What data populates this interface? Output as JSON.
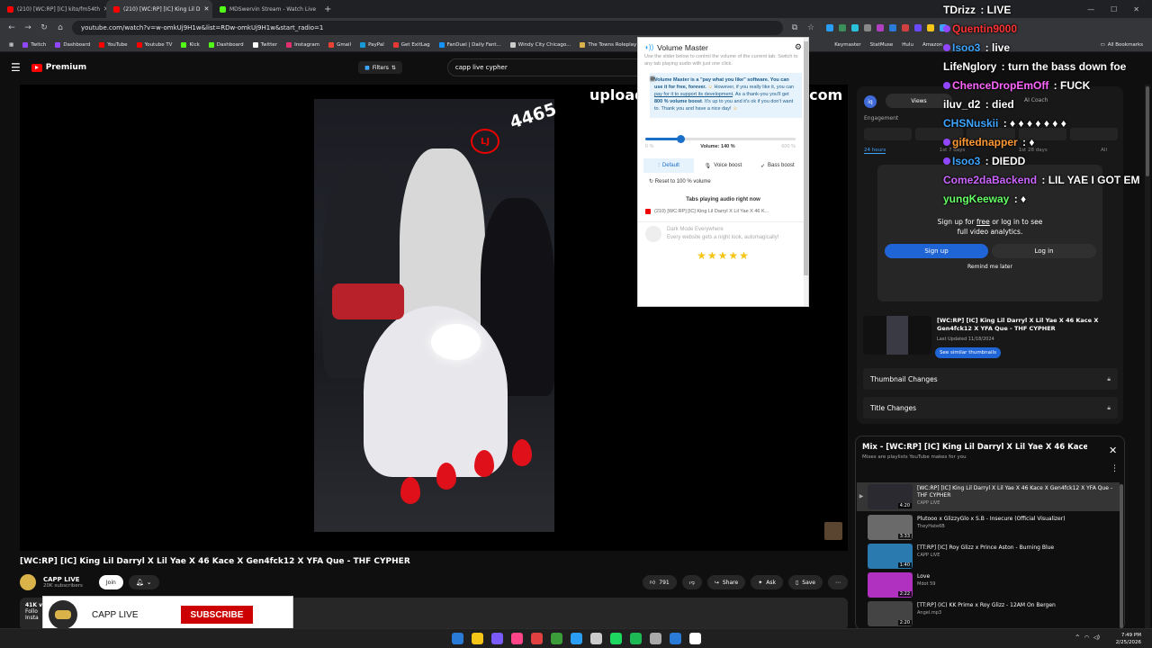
{
  "browser": {
    "tabs": [
      {
        "label": "(210) [WC:RP] [IC] kito/fm54th",
        "favicon": "#ff0000",
        "active": false
      },
      {
        "label": "(210) [WC:RP] [IC] King Lil D",
        "favicon": "#ff0000",
        "active": true
      },
      {
        "label": "MDSwervin Stream - Watch Live",
        "favicon": "#53fc18",
        "active": false
      }
    ],
    "url": "youtube.com/watch?v=w-omkUj9H1w&list=RDw-omkUj9H1w&start_radio=1",
    "bookmarks": [
      {
        "label": "Twitch",
        "color": "#9146ff"
      },
      {
        "label": "Dashboard",
        "color": "#9146ff"
      },
      {
        "label": "YouTube",
        "color": "#ff0000"
      },
      {
        "label": "Youtube TV",
        "color": "#ff0000"
      },
      {
        "label": "Kick",
        "color": "#53fc18"
      },
      {
        "label": "Dashboard",
        "color": "#53fc18"
      },
      {
        "label": "Twitter",
        "color": "#ffffff"
      },
      {
        "label": "Instagram",
        "color": "#e1306c"
      },
      {
        "label": "Gmail",
        "color": "#ea4335"
      },
      {
        "label": "PayPal",
        "color": "#179bd7"
      },
      {
        "label": "Get ExitLag",
        "color": "#e53935"
      },
      {
        "label": "FanDuel | Daily Fant...",
        "color": "#1493ff"
      },
      {
        "label": "Windy City Chicago...",
        "color": "#cccccc"
      },
      {
        "label": "The Towns Roleplay",
        "color": "#d9b24a"
      }
    ],
    "bookmarks_right": "All Bookmarks",
    "ext_bookmarks": [
      "Keymaster",
      "StatMuse",
      "Hulu",
      "Amazon"
    ]
  },
  "youtube": {
    "brand": "Premium",
    "filters_label": "Filters",
    "search_value": "capp live cypher",
    "watermark_left": "upload",
    "watermark_right": ".com",
    "overlay_number": "4465",
    "video_title": "[WC:RP] [IC] King Lil Darryl X Lil Yae X 46 Kace X Gen4fck12 X YFA Que - THF CYPHER",
    "channel_name": "CAPP LIVE",
    "channel_subs": "20K subscribers",
    "join_label": "Join",
    "likes": "791",
    "share_label": "Share",
    "ask_label": "Ask",
    "save_label": "Save",
    "desc_lines": [
      "41K v",
      "Follo",
      "Insta"
    ]
  },
  "subscribe_card": {
    "name": "CAPP LIVE",
    "button": "SUBSCRIBE"
  },
  "volume_master": {
    "title": "Volume Master",
    "subtitle": "Use the slider below to control the volume of the current tab. Switch to any tab playing audio with just one click.",
    "info_bold": "Volume Master is a \"pay what you like\" software. You can use it for free, forever.",
    "info_text_1": "However, if you really like it, you can",
    "info_link": "pay for it to support its development",
    "info_text_2": ". As a thank-you you'll get",
    "info_bold_2": "800 % volume boost",
    "info_text_3": ". It's up to you and it's ok if you don't want to. Thank you and have a nice day!",
    "min_label": "0 %",
    "volume_label": "Volume: 140 %",
    "max_label": "600 %",
    "volume_value": 140,
    "volume_max": 600,
    "modes": [
      "Default",
      "Voice boost",
      "Bass boost"
    ],
    "reset_label": "Reset to 100 % volume",
    "tabs_heading": "Tabs playing audio right now",
    "tab_item": "(210) [WC:RP] [IC] King Lil Darryl X Lil Yae X 46 K...",
    "dark_title": "Dark Mode Everywhere",
    "dark_sub": "Every website gets a night look, automagically!",
    "stars": "★★★★★"
  },
  "right_panel": {
    "views_label": "Views",
    "ai_coach": "AI Coach",
    "engagement": "Engagement",
    "time_tabs": [
      "24 hours",
      "1st 7 days",
      "1st 28 days",
      "All"
    ],
    "signup_text_1": "Sign up for",
    "signup_free": "free",
    "signup_text_2": "or log in to see full video analytics.",
    "signup_btn": "Sign up",
    "login_btn": "Log in",
    "remind": "Remind me later",
    "rec_title": "[WC:RP] [IC] King Lil Darryl X Lil Yae X 46 Kace X Gen4fck12 X YFA Que - THF CYPHER",
    "rec_updated": "Last Updated 11/18/2024",
    "similar_btn": "See similar thumbnails",
    "thumbnail_changes": "Thumbnail Changes",
    "title_changes": "Title Changes"
  },
  "mix": {
    "title": "Mix - [WC:RP] [IC] King Lil Darryl X Lil Yae X 46 Kace X...",
    "subtitle": "Mixes are playlists YouTube makes for you",
    "items": [
      {
        "title": "[WC:RP] [IC] King Lil Darryl X Lil Yae X 46 Kace X Gen4fck12 X YFA Que - THF CYPHER",
        "channel": "CAPP LIVE",
        "duration": "4:20",
        "color": "#2a2a30"
      },
      {
        "title": "Plutooo x GlizzyGlo x S.B - Insecure (Official Visualizer)",
        "channel": "TheyHate6B",
        "duration": "3:33",
        "color": "#6a6a6a"
      },
      {
        "title": "[TT:RP] [IC] Roy Glizz x Prince Aston - Burning Blue",
        "channel": "CAPP LIVE",
        "duration": "1:40",
        "color": "#2a7ab0"
      },
      {
        "title": "Love",
        "channel": "Mdot 59",
        "duration": "2:22",
        "color": "#b030c0"
      },
      {
        "title": "[TT:RP] (IC) KK Prime x Roy Glizz - 12AM On Bergen",
        "channel": "Angel.mp3",
        "duration": "2:20",
        "color": "#444444"
      }
    ]
  },
  "chat": [
    {
      "user": "TDrizz",
      "msg": " : LIVE",
      "color": "#ffffff",
      "badge": false
    },
    {
      "user": "Quentin9000",
      "msg": "",
      "color": "#ff3333",
      "badge": true
    },
    {
      "user": "Isoo3",
      "msg": " : live",
      "color": "#3ea6ff",
      "badge": true
    },
    {
      "user": "LifeNglory",
      "msg": " : turn the bass down foe",
      "color": "#ffffff",
      "badge": false
    },
    {
      "user": "ChenceDropEmOff",
      "msg": " : FUCK",
      "color": "#ff66ff",
      "badge": true
    },
    {
      "user": "iluv_d2",
      "msg": " : died",
      "color": "#ffffff",
      "badge": false
    },
    {
      "user": "CHSNuskii",
      "msg": " : ♦ ♦ ♦ ♦ ♦ ♦ ♦",
      "color": "#3ea6ff",
      "badge": false
    },
    {
      "user": "giftednapper",
      "msg": " : ♦",
      "color": "#ff9933",
      "badge": true
    },
    {
      "user": "Isoo3",
      "msg": " : DIEDD",
      "color": "#3ea6ff",
      "badge": true
    },
    {
      "user": "Come2daBackend",
      "msg": " : LIL YAE I GOT EM",
      "color": "#cc66ff",
      "badge": false
    },
    {
      "user": "yungKeeway",
      "msg": " : ♦",
      "color": "#66ff66",
      "badge": false
    }
  ],
  "taskbar": {
    "time": "7:49 PM",
    "date": "2/25/2026",
    "icons": [
      "#2a7ad8",
      "#f5c518",
      "#7a5af8",
      "#ff4488",
      "#e04040",
      "#3a9d3a",
      "#2a9df4",
      "#cccccc",
      "#1ed760",
      "#1db954",
      "#aaaaaa",
      "#2a7ad8",
      "#ffffff"
    ]
  }
}
